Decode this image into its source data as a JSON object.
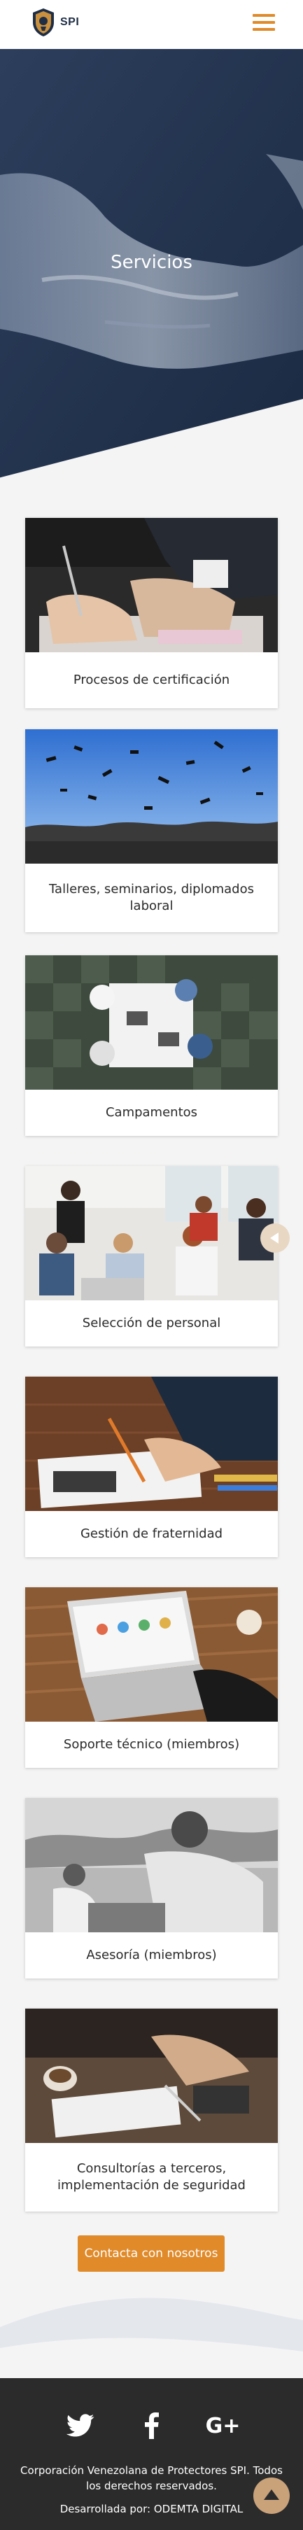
{
  "header": {
    "logo_text": "SPI",
    "menu_icon": "hamburger-menu-icon"
  },
  "hero": {
    "title": "Servicios"
  },
  "services": [
    {
      "label": "Procesos de certificación"
    },
    {
      "label": "Talleres, seminarios, diplomados laboral"
    },
    {
      "label": "Campamentos"
    },
    {
      "label": "Selección de personal"
    },
    {
      "label": "Gestión de fraternidad"
    },
    {
      "label": "Soporte técnico (miembros)"
    },
    {
      "label": "Asesoría (miembros)"
    },
    {
      "label": "Consultorías a terceros, implementación de seguridad"
    }
  ],
  "cta": {
    "label": "Contacta con nosotros"
  },
  "footer": {
    "social": [
      "twitter-icon",
      "facebook-icon",
      "google-plus-icon"
    ],
    "google_plus_text": "G+",
    "copyright": "Corporación Venezolana de Protectores SPI. Todos los derechos reservados.",
    "developer": "Desarrollada por: ODEMTA DIGITAL"
  },
  "colors": {
    "accent": "#e08a2a",
    "navy": "#1f2e45",
    "footer_bg": "#2b2b2b"
  }
}
